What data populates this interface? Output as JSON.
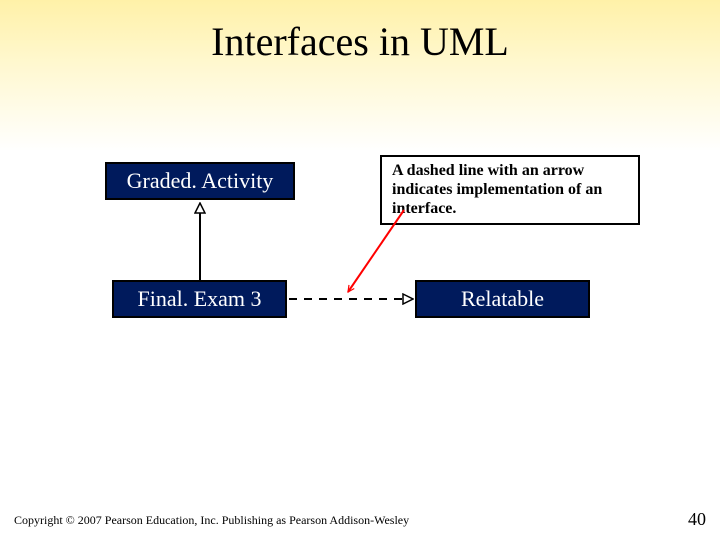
{
  "title": "Interfaces in UML",
  "box_graded": "Graded. Activity",
  "box_final": "Final. Exam 3",
  "box_relatable": "Relatable",
  "note_text": "A dashed line with an arrow indicates implementation of an interface.",
  "footer": "Copyright © 2007 Pearson Education, Inc. Publishing as Pearson Addison-Wesley",
  "page_number": "40",
  "colors": {
    "class_fill": "#001a5c",
    "callout_arrow": "#ff0000"
  }
}
